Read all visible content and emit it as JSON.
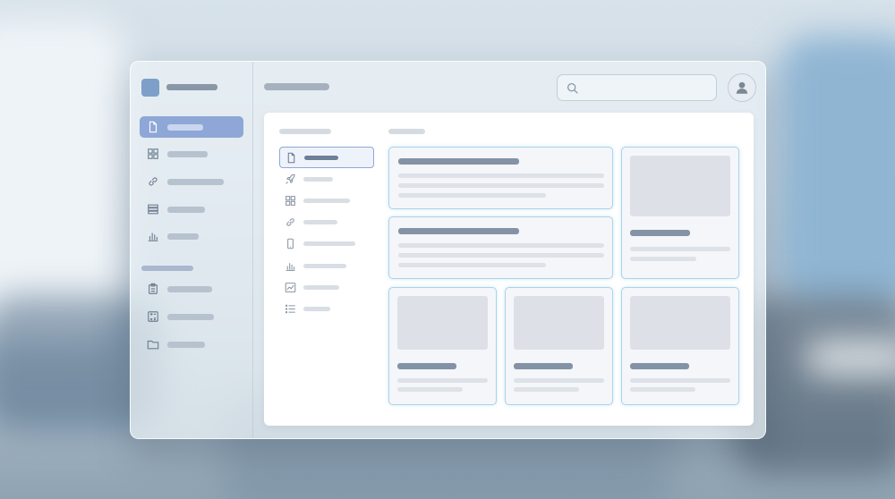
{
  "search": {
    "placeholder": ""
  },
  "icons": {
    "sidebar": [
      "document-icon",
      "grid-icon",
      "link-icon",
      "stack-icon",
      "bar-chart-icon",
      "clipboard-icon",
      "calculator-icon",
      "folder-icon"
    ],
    "nav": [
      "document-icon",
      "rocket-icon",
      "grid-icon",
      "link-icon",
      "phone-icon",
      "bar-chart-icon",
      "line-chart-icon",
      "list-icon"
    ],
    "header": [
      "search-icon",
      "user-avatar-icon"
    ]
  },
  "colors": {
    "accent": "#8ea7d6",
    "card_border": "#a9d3ea",
    "title_bar": "#8492a6",
    "placeholder_bar": "#dde2e8"
  }
}
